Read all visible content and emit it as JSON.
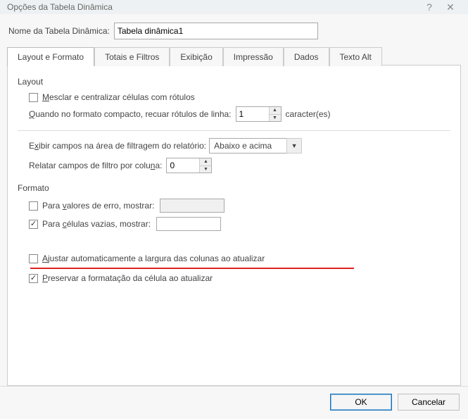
{
  "titlebar": {
    "title": "Opções da Tabela Dinâmica",
    "help_icon": "?",
    "close_icon": "✕"
  },
  "name_row": {
    "label": "Nome da Tabela Dinâmica:",
    "value": "Tabela dinâmica1"
  },
  "tabs": [
    "Layout e Formato",
    "Totais e Filtros",
    "Exibição",
    "Impressão",
    "Dados",
    "Texto Alt"
  ],
  "group_layout": {
    "title": "Layout",
    "merge_cells": "Mesclar e centralizar células com rótulos",
    "merge_u": "M",
    "compact_label_pre": "Q",
    "compact_label": "uando no formato compacto, recuar rótulos de linha:",
    "compact_val": "1",
    "compact_suffix": "caracter(es)",
    "filter_area_label": "Exibir campos na área de filtragem do relatório:",
    "filter_area_u": "x",
    "filter_area_sel": "Abaixo e acima",
    "fields_per_col_pre": "Relatar campos de filtro por colu",
    "fields_per_col_u": "n",
    "fields_per_col_post": "a:",
    "fields_per_col_val": "0"
  },
  "group_format": {
    "title": "Formato",
    "err_label_pre": "Para ",
    "err_u": "v",
    "err_label_post": "alores de erro, mostrar:",
    "err_value": "",
    "empty_label_pre": "Para ",
    "empty_u": "c",
    "empty_label_post": "élulas vazias, mostrar:",
    "empty_value": "",
    "autofit_u": "A",
    "autofit_label": "justar automaticamente a largura das colunas ao atualizar",
    "preserve_u": "P",
    "preserve_label": "reservar a formatação da célula ao atualizar"
  },
  "footer": {
    "ok": "OK",
    "cancel": "Cancelar"
  }
}
